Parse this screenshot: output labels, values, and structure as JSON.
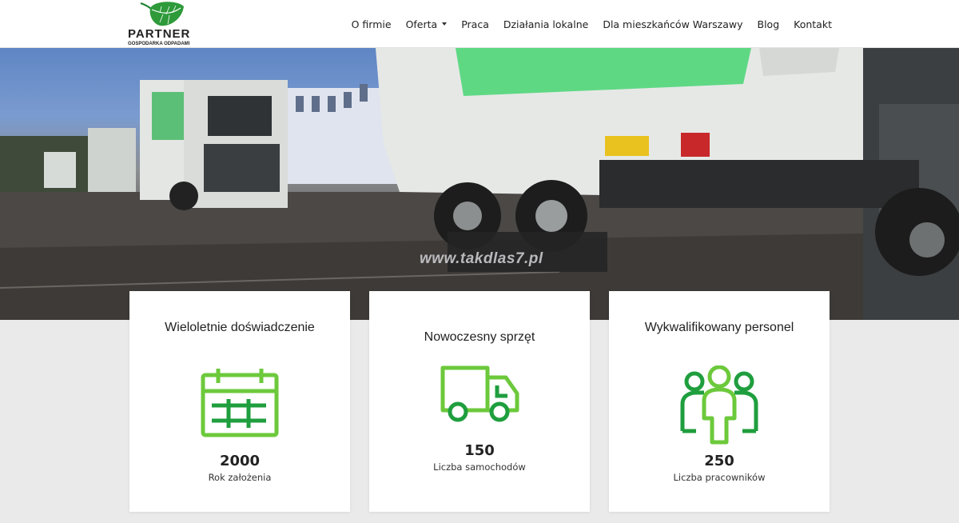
{
  "logo": {
    "name": "PARTNER",
    "tagline": "GOSPODARKA ODPADAMI"
  },
  "nav": {
    "items": [
      {
        "label": "O firmie"
      },
      {
        "label": "Oferta",
        "has_dropdown": true
      },
      {
        "label": "Praca"
      },
      {
        "label": "Działania lokalne"
      },
      {
        "label": "Dla mieszkańców Warszawy"
      },
      {
        "label": "Blog"
      },
      {
        "label": "Kontakt"
      }
    ]
  },
  "hero": {
    "watermark": "www.takdlas7.pl"
  },
  "cards": [
    {
      "title": "Wieloletnie doświadczenie",
      "icon": "calendar-icon",
      "number": "2000",
      "label": "Rok założenia"
    },
    {
      "title": "Nowoczesny sprzęt",
      "icon": "truck-icon",
      "number": "150",
      "label": "Liczba samochodów"
    },
    {
      "title": "Wykwalifikowany personel",
      "icon": "people-icon",
      "number": "250",
      "label": "Liczba pracowników"
    }
  ],
  "colors": {
    "accent_green": "#6cc93b",
    "dark_green": "#1f9e3e",
    "header_bg": "#ffffff",
    "page_bg": "#eaeaea"
  }
}
